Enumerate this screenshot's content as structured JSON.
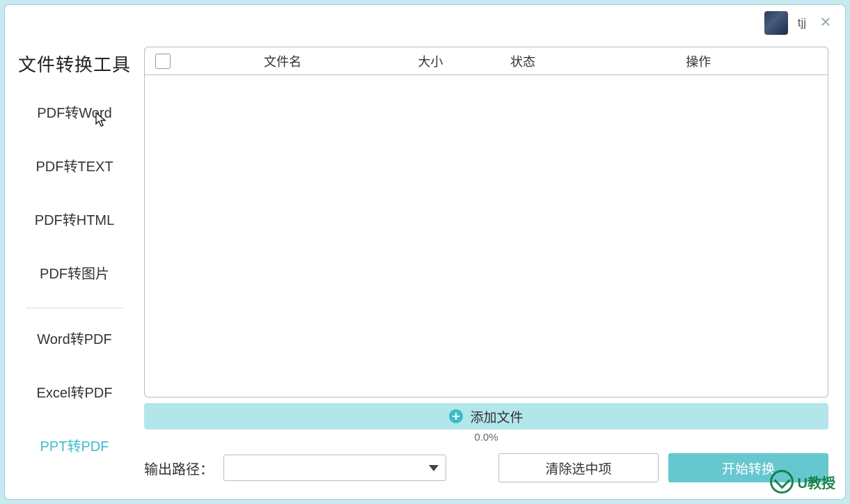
{
  "titlebar": {
    "username": "tjj",
    "close": "×"
  },
  "sidebar": {
    "title": "文件转换工具",
    "items": [
      {
        "label": "PDF转Word"
      },
      {
        "label": "PDF转TEXT"
      },
      {
        "label": "PDF转HTML"
      },
      {
        "label": "PDF转图片"
      },
      {
        "label": "Word转PDF"
      },
      {
        "label": "Excel转PDF"
      },
      {
        "label": "PPT转PDF"
      }
    ]
  },
  "table": {
    "headers": {
      "name": "文件名",
      "size": "大小",
      "status": "状态",
      "action": "操作"
    },
    "rows": []
  },
  "add_file": {
    "label": "添加文件"
  },
  "progress": {
    "text": "0.0%"
  },
  "footer": {
    "output_label": "输出路径：",
    "output_value": "",
    "clear_label": "清除选中项",
    "start_label": "开始转换"
  },
  "watermark": {
    "text": "U教授"
  }
}
